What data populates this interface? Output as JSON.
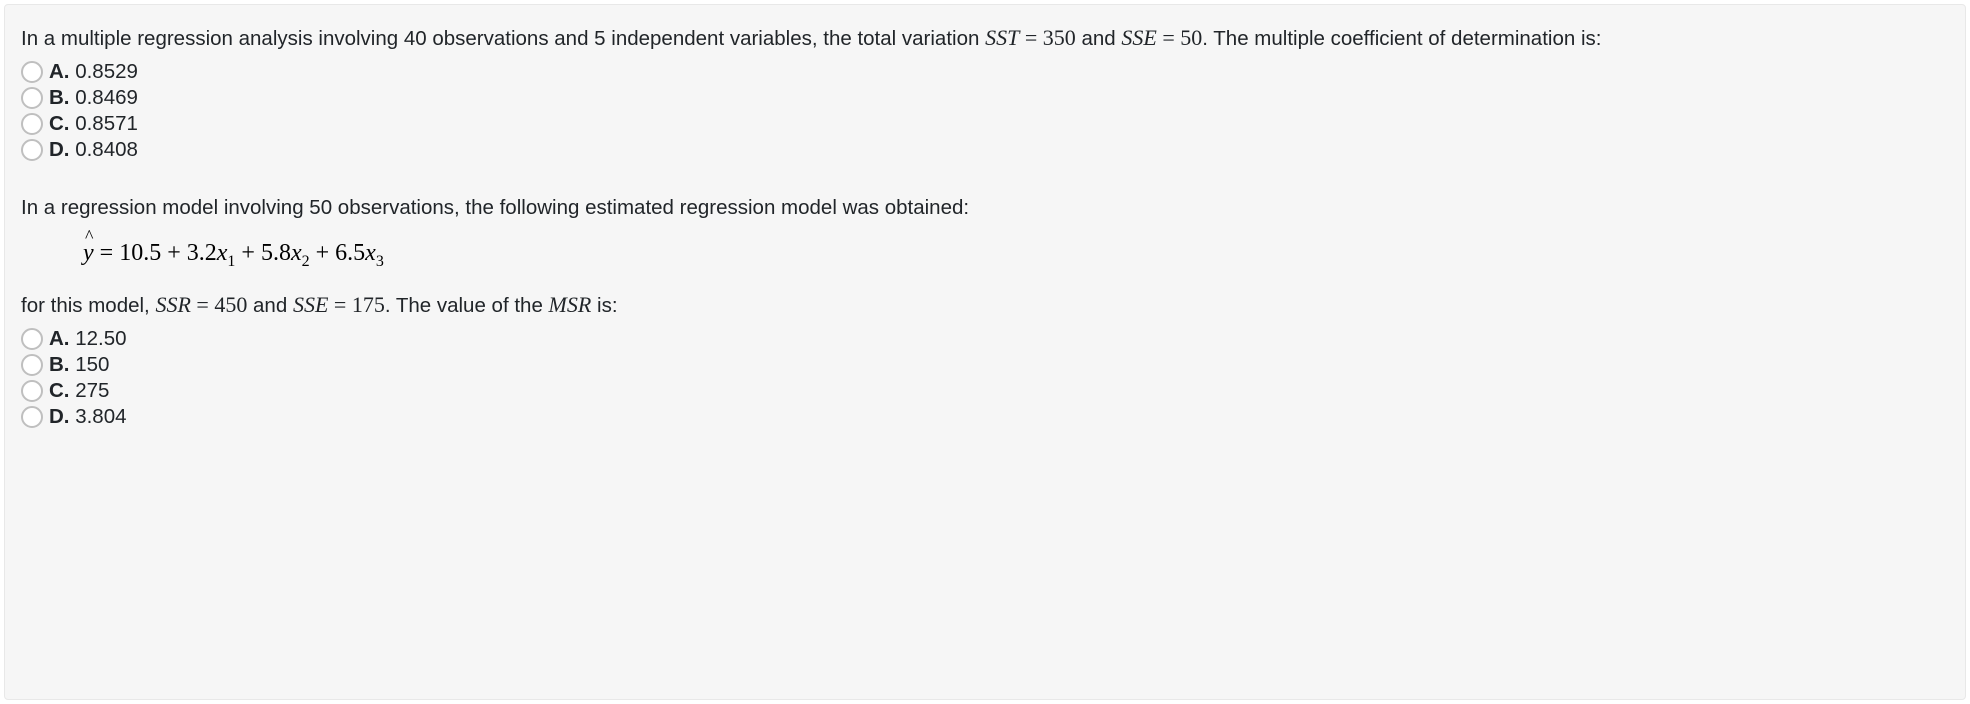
{
  "q1": {
    "text_pre": "In a multiple regression analysis involving 40 observations and 5 independent variables, the total variation ",
    "eq1_lhs": "SST",
    "eq1_mid": " = ",
    "eq1_rhs": "350",
    "text_mid1": " and ",
    "eq2_lhs": "SSE",
    "eq2_mid": " = ",
    "eq2_rhs": "50",
    "text_post": ". The multiple coefficient of determination is:",
    "choices": {
      "a": {
        "letter": "A.",
        "value": "0.8529"
      },
      "b": {
        "letter": "B.",
        "value": "0.8469"
      },
      "c": {
        "letter": "C.",
        "value": "0.8571"
      },
      "d": {
        "letter": "D.",
        "value": "0.8408"
      }
    }
  },
  "q2": {
    "text1": "In a regression model involving 50 observations, the following estimated regression model was obtained:",
    "equation": {
      "yhat": "y",
      "eq": " = ",
      "c0": "10.5",
      "p1": " + ",
      "c1": "3.2",
      "x1": "x",
      "s1": "1",
      "p2": " + ",
      "c2": "5.8",
      "x2": "x",
      "s2": "2",
      "p3": " + ",
      "c3": "6.5",
      "x3": "x",
      "s3": "3"
    },
    "text2_pre": "for this model, ",
    "eq1_lhs": "SSR",
    "eq1_mid": " = ",
    "eq1_rhs": "450",
    "text2_mid1": " and ",
    "eq2_lhs": "SSE",
    "eq2_mid": " = ",
    "eq2_rhs": "175",
    "text2_mid2": ". The value of the ",
    "eq3": "MSR",
    "text2_post": " is:",
    "choices": {
      "a": {
        "letter": "A.",
        "value": "12.50"
      },
      "b": {
        "letter": "B.",
        "value": "150"
      },
      "c": {
        "letter": "C.",
        "value": "275"
      },
      "d": {
        "letter": "D.",
        "value": "3.804"
      }
    }
  }
}
